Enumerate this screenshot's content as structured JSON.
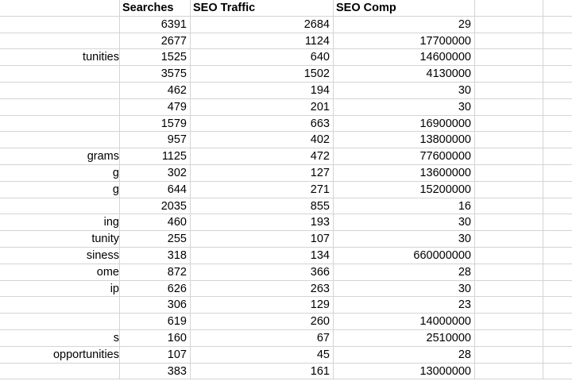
{
  "headers": {
    "searches": "Searches",
    "seo_traffic": "SEO Traffic",
    "seo_comp": "SEO Comp"
  },
  "rows": [
    {
      "keyword": "",
      "searches": "6391",
      "traffic": "2684",
      "comp": "29"
    },
    {
      "keyword": "",
      "searches": "2677",
      "traffic": "1124",
      "comp": "17700000"
    },
    {
      "keyword": "tunities",
      "searches": "1525",
      "traffic": "640",
      "comp": "14600000"
    },
    {
      "keyword": "",
      "searches": "3575",
      "traffic": "1502",
      "comp": "4130000"
    },
    {
      "keyword": "",
      "searches": "462",
      "traffic": "194",
      "comp": "30"
    },
    {
      "keyword": "",
      "searches": "479",
      "traffic": "201",
      "comp": "30"
    },
    {
      "keyword": "",
      "searches": "1579",
      "traffic": "663",
      "comp": "16900000"
    },
    {
      "keyword": "",
      "searches": "957",
      "traffic": "402",
      "comp": "13800000"
    },
    {
      "keyword": "grams",
      "searches": "1125",
      "traffic": "472",
      "comp": "77600000"
    },
    {
      "keyword": "g",
      "searches": "302",
      "traffic": "127",
      "comp": "13600000"
    },
    {
      "keyword": "g",
      "searches": "644",
      "traffic": "271",
      "comp": "15200000"
    },
    {
      "keyword": "",
      "searches": "2035",
      "traffic": "855",
      "comp": "16"
    },
    {
      "keyword": "ing",
      "searches": "460",
      "traffic": "193",
      "comp": "30"
    },
    {
      "keyword": "tunity",
      "searches": "255",
      "traffic": "107",
      "comp": "30"
    },
    {
      "keyword": "siness",
      "searches": "318",
      "traffic": "134",
      "comp": "660000000"
    },
    {
      "keyword": "ome",
      "searches": "872",
      "traffic": "366",
      "comp": "28"
    },
    {
      "keyword": "ip",
      "searches": "626",
      "traffic": "263",
      "comp": "30"
    },
    {
      "keyword": "",
      "searches": "306",
      "traffic": "129",
      "comp": "23"
    },
    {
      "keyword": "",
      "searches": "619",
      "traffic": "260",
      "comp": "14000000"
    },
    {
      "keyword": "s",
      "searches": "160",
      "traffic": "67",
      "comp": "2510000"
    },
    {
      "keyword": " opportunities",
      "searches": "107",
      "traffic": "45",
      "comp": "28"
    },
    {
      "keyword": "",
      "searches": "383",
      "traffic": "161",
      "comp": "13000000"
    }
  ]
}
